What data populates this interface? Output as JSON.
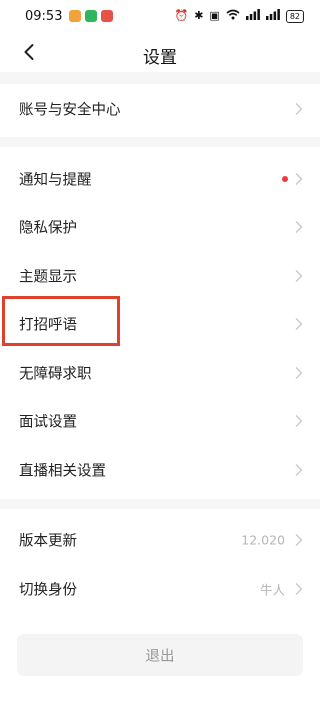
{
  "status_bar": {
    "time": "09:53",
    "battery": "82"
  },
  "nav": {
    "title": "设置"
  },
  "section1": [
    {
      "label": "账号与安全中心"
    }
  ],
  "section2": [
    {
      "label": "通知与提醒",
      "has_dot": true
    },
    {
      "label": "隐私保护"
    },
    {
      "label": "主题显示"
    },
    {
      "label": "打招呼语",
      "highlighted": true
    },
    {
      "label": "无障碍求职"
    },
    {
      "label": "面试设置"
    },
    {
      "label": "直播相关设置"
    }
  ],
  "section3": [
    {
      "label": "版本更新",
      "value": "12.020"
    },
    {
      "label": "切换身份",
      "value": "牛人"
    }
  ],
  "logout_label": "退出",
  "colors": {
    "dot": "#ee3b3b",
    "highlight": "#e0412b",
    "chevron": "#c8c8c8",
    "value_text": "#b5b5b5"
  }
}
